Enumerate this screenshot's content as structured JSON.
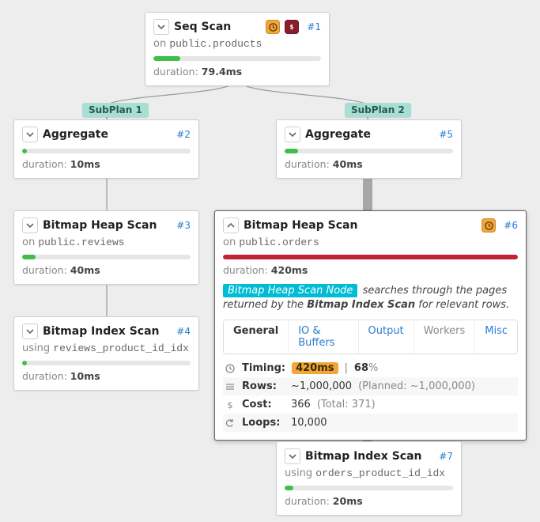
{
  "subplans": {
    "left": "SubPlan 1",
    "right": "SubPlan 2"
  },
  "labels": {
    "duration_prefix": "duration:",
    "on_prefix": "on",
    "using_prefix": "using"
  },
  "nodes": {
    "n1": {
      "id": "#1",
      "title": "Seq Scan",
      "on": "public.products",
      "duration": "79.4ms",
      "bar_pct": 16,
      "bar_color": "green",
      "has_warn": true,
      "has_cost": true
    },
    "n2": {
      "id": "#2",
      "title": "Aggregate",
      "duration": "10ms",
      "bar_pct": 3,
      "bar_color": "green"
    },
    "n3": {
      "id": "#3",
      "title": "Bitmap Heap Scan",
      "on": "public.reviews",
      "duration": "40ms",
      "bar_pct": 8,
      "bar_color": "green"
    },
    "n4": {
      "id": "#4",
      "title": "Bitmap Index Scan",
      "using": "reviews_product_id_idx",
      "duration": "10ms",
      "bar_pct": 3,
      "bar_color": "green"
    },
    "n5": {
      "id": "#5",
      "title": "Aggregate",
      "duration": "40ms",
      "bar_pct": 8,
      "bar_color": "green"
    },
    "n6": {
      "id": "#6",
      "title": "Bitmap Heap Scan",
      "on": "public.orders",
      "duration": "420ms",
      "bar_pct": 100,
      "bar_color": "red",
      "has_warn": true,
      "desc_tag": "Bitmap Heap Scan Node",
      "desc_mid": " searches through the pages returned by the ",
      "desc_bold": "Bitmap Index Scan",
      "desc_tail": " for relevant rows."
    },
    "n7": {
      "id": "#7",
      "title": "Bitmap Index Scan",
      "using": "orders_product_id_idx",
      "duration": "20ms",
      "bar_pct": 5,
      "bar_color": "green"
    }
  },
  "tabs": {
    "general": "General",
    "io": "IO & Buffers",
    "output": "Output",
    "workers": "Workers",
    "misc": "Misc"
  },
  "stats": {
    "timing_label": "Timing:",
    "timing_value": "420ms",
    "timing_sep": "|",
    "timing_pct": "68",
    "timing_pct_suffix": "%",
    "rows_label": "Rows:",
    "rows_value": "~1,000,000",
    "rows_planned": "(Planned: ~1,000,000)",
    "cost_label": "Cost:",
    "cost_value": "366",
    "cost_total": "(Total: 371)",
    "loops_label": "Loops:",
    "loops_value": "10,000"
  }
}
